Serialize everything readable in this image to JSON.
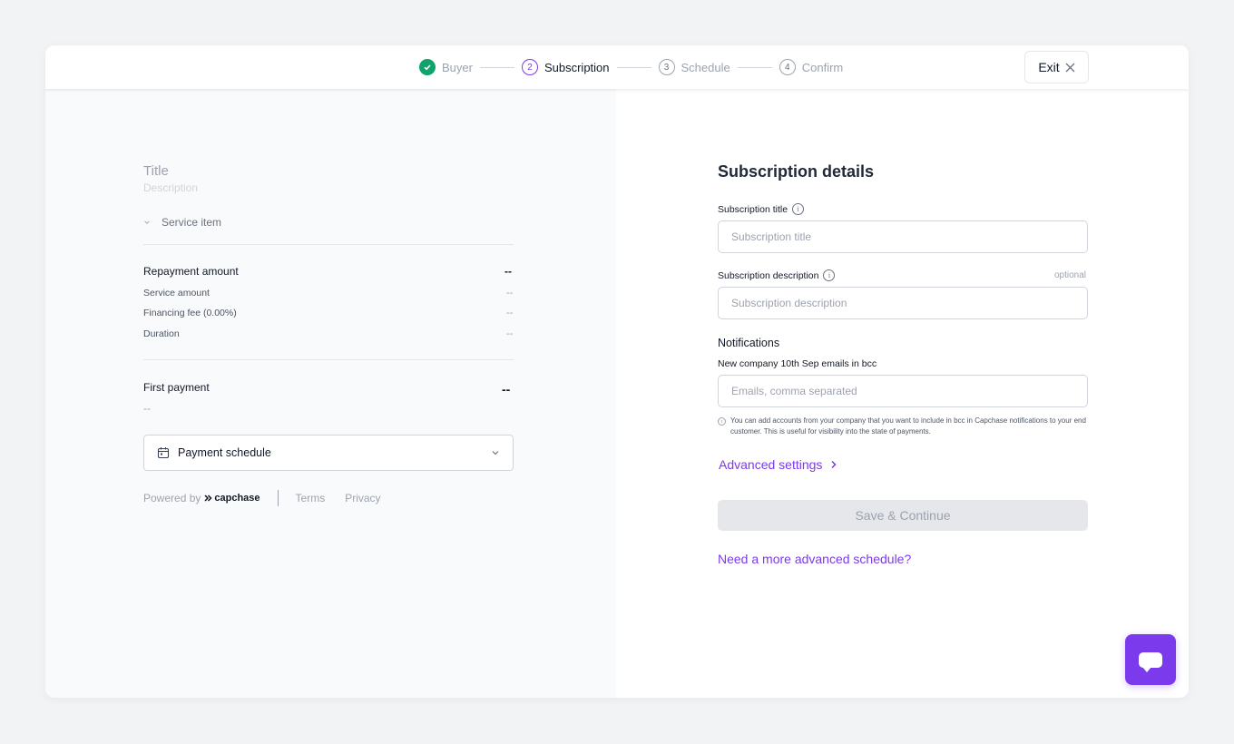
{
  "stepper": {
    "steps": [
      {
        "number": "",
        "label": "Buyer",
        "state": "done"
      },
      {
        "number": "2",
        "label": "Subscription",
        "state": "active"
      },
      {
        "number": "3",
        "label": "Schedule",
        "state": "pending"
      },
      {
        "number": "4",
        "label": "Confirm",
        "state": "pending"
      }
    ]
  },
  "header": {
    "exit_label": "Exit"
  },
  "summary": {
    "title": "Title",
    "description": "Description",
    "service_item": "Service item",
    "repayment": {
      "label": "Repayment amount",
      "value": "--",
      "rows": [
        {
          "label": "Service amount",
          "value": "--"
        },
        {
          "label": "Financing fee (0.00%)",
          "value": "--"
        },
        {
          "label": "Duration",
          "value": "--"
        }
      ]
    },
    "first_payment": {
      "label": "First payment",
      "value": "--",
      "sub": "--"
    },
    "payment_schedule": "Payment schedule"
  },
  "footer": {
    "powered_by": "Powered by",
    "brand": "capchase",
    "terms": "Terms",
    "privacy": "Privacy"
  },
  "form": {
    "heading": "Subscription details",
    "title_label": "Subscription title",
    "title_placeholder": "Subscription title",
    "description_label": "Subscription description",
    "optional": "optional",
    "description_placeholder": "Subscription description",
    "notifications_heading": "Notifications",
    "emails_label": "New company 10th Sep emails in bcc",
    "emails_placeholder": "Emails, comma separated",
    "help_text": "You can add accounts from your company that you want to include in bcc in Capchase notifications to your end customer. This is useful for visibility into the state of payments.",
    "advanced_settings": "Advanced settings",
    "save_label": "Save & Continue",
    "advanced_schedule_link": "Need a more advanced schedule?"
  },
  "colors": {
    "accent": "#7c3aed",
    "success": "#10a36b"
  }
}
